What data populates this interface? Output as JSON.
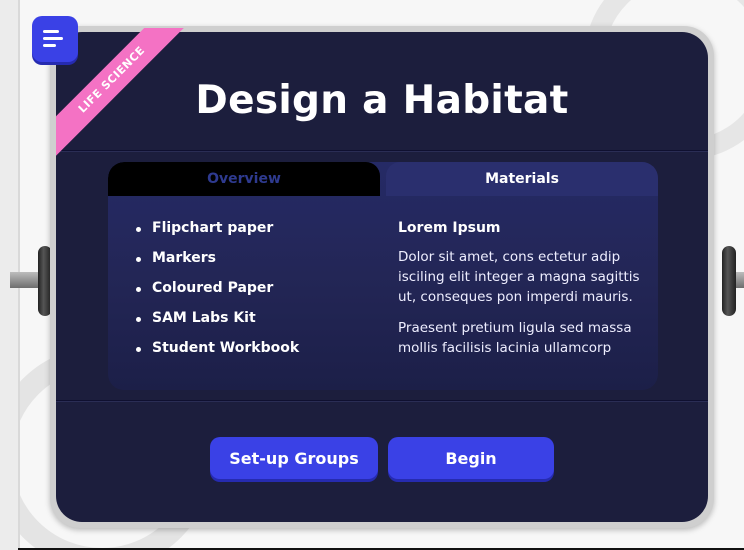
{
  "header": {
    "title": "Design a Habitat",
    "badge": "LIFE SCIENCE"
  },
  "tabs": [
    {
      "label": "Overview",
      "active": false
    },
    {
      "label": "Materials",
      "active": true
    }
  ],
  "materials": {
    "items": [
      "Flipchart paper",
      "Markers",
      "Coloured Paper",
      "SAM Labs Kit",
      "Student Workbook"
    ],
    "heading": "Lorem Ipsum",
    "paragraphs": [
      "Dolor sit amet, cons ectetur adip isciling elit integer a magna sagittis ut, conseques pon imperdi mauris.",
      "Praesent pretium ligula sed massa mollis facilisis lacinia ullamcorp"
    ]
  },
  "actions": {
    "setup_label": "Set-up Groups",
    "begin_label": "Begin"
  },
  "icons": {
    "menu": "menu-icon"
  },
  "colors": {
    "accent": "#3a41e6",
    "panel": "#1c1e3d",
    "ribbon": "#f472c4"
  }
}
